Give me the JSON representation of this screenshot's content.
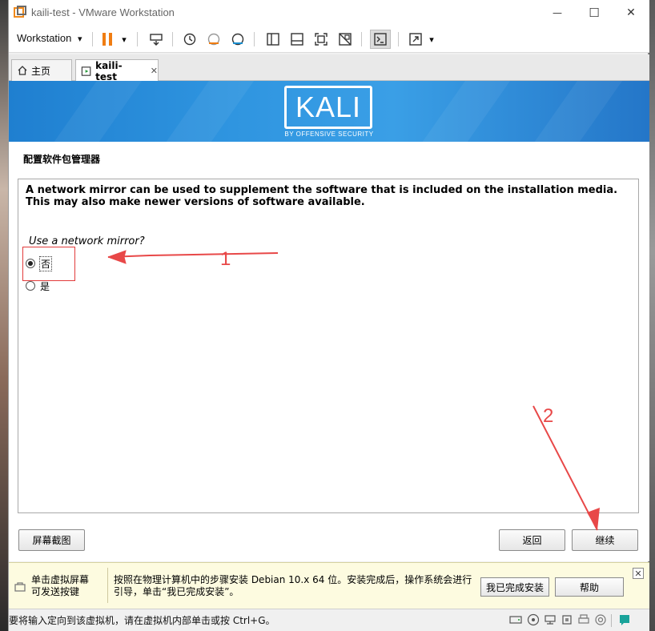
{
  "window": {
    "title": "kaili-test - VMware Workstation",
    "minimize_glyph": "—",
    "maximize_glyph": "☐",
    "close_glyph": "✕"
  },
  "toolbar": {
    "menu_label": "Workstation",
    "menu_caret": "▾",
    "pause_caret": "▾",
    "stretch_caret": "▾"
  },
  "tabs": [
    {
      "label": "主页"
    },
    {
      "label": "kaili-test",
      "close_glyph": "✕"
    }
  ],
  "installer": {
    "logo_text": "KALI",
    "logo_subtitle": "BY OFFENSIVE SECURITY",
    "section_title": "配置软件包管理器",
    "description": "A network mirror can be used to supplement the software that is included on the installation media. This may also make newer versions of software available.",
    "question": "Use a network mirror?",
    "options": [
      {
        "label": "否",
        "selected": true
      },
      {
        "label": "是",
        "selected": false
      }
    ],
    "screenshot_button": "屏幕截图",
    "back_button": "返回",
    "continue_button": "继续"
  },
  "annotations": {
    "step1": "1",
    "step2": "2",
    "color": "#e84848"
  },
  "hint": {
    "left_text": "单击虚拟屏幕\n可发送按键",
    "message": "按照在物理计算机中的步骤安装 Debian 10.x 64 位。安装完成后，操作系统会进行引导，单击“我已完成安装”。",
    "done_button": "我已完成安装",
    "help_button": "帮助",
    "close_glyph": "✕"
  },
  "status": {
    "text": "要将输入定向到该虚拟机，请在虚拟机内部单击或按 Ctrl+G。"
  },
  "colors": {
    "kali_blue": "#2f95e0",
    "pause_orange": "#f07d12",
    "annotation_red": "#e84848",
    "hint_bg": "#fdfbe0"
  }
}
